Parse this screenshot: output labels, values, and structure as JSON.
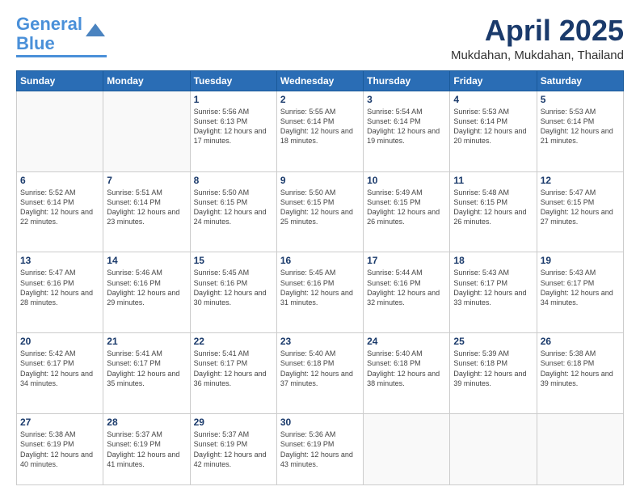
{
  "logo": {
    "line1": "General",
    "line2": "Blue"
  },
  "header": {
    "month": "April 2025",
    "location": "Mukdahan, Mukdahan, Thailand"
  },
  "weekdays": [
    "Sunday",
    "Monday",
    "Tuesday",
    "Wednesday",
    "Thursday",
    "Friday",
    "Saturday"
  ],
  "weeks": [
    [
      {
        "day": "",
        "info": ""
      },
      {
        "day": "",
        "info": ""
      },
      {
        "day": "1",
        "info": "Sunrise: 5:56 AM\nSunset: 6:13 PM\nDaylight: 12 hours and 17 minutes."
      },
      {
        "day": "2",
        "info": "Sunrise: 5:55 AM\nSunset: 6:14 PM\nDaylight: 12 hours and 18 minutes."
      },
      {
        "day": "3",
        "info": "Sunrise: 5:54 AM\nSunset: 6:14 PM\nDaylight: 12 hours and 19 minutes."
      },
      {
        "day": "4",
        "info": "Sunrise: 5:53 AM\nSunset: 6:14 PM\nDaylight: 12 hours and 20 minutes."
      },
      {
        "day": "5",
        "info": "Sunrise: 5:53 AM\nSunset: 6:14 PM\nDaylight: 12 hours and 21 minutes."
      }
    ],
    [
      {
        "day": "6",
        "info": "Sunrise: 5:52 AM\nSunset: 6:14 PM\nDaylight: 12 hours and 22 minutes."
      },
      {
        "day": "7",
        "info": "Sunrise: 5:51 AM\nSunset: 6:14 PM\nDaylight: 12 hours and 23 minutes."
      },
      {
        "day": "8",
        "info": "Sunrise: 5:50 AM\nSunset: 6:15 PM\nDaylight: 12 hours and 24 minutes."
      },
      {
        "day": "9",
        "info": "Sunrise: 5:50 AM\nSunset: 6:15 PM\nDaylight: 12 hours and 25 minutes."
      },
      {
        "day": "10",
        "info": "Sunrise: 5:49 AM\nSunset: 6:15 PM\nDaylight: 12 hours and 26 minutes."
      },
      {
        "day": "11",
        "info": "Sunrise: 5:48 AM\nSunset: 6:15 PM\nDaylight: 12 hours and 26 minutes."
      },
      {
        "day": "12",
        "info": "Sunrise: 5:47 AM\nSunset: 6:15 PM\nDaylight: 12 hours and 27 minutes."
      }
    ],
    [
      {
        "day": "13",
        "info": "Sunrise: 5:47 AM\nSunset: 6:16 PM\nDaylight: 12 hours and 28 minutes."
      },
      {
        "day": "14",
        "info": "Sunrise: 5:46 AM\nSunset: 6:16 PM\nDaylight: 12 hours and 29 minutes."
      },
      {
        "day": "15",
        "info": "Sunrise: 5:45 AM\nSunset: 6:16 PM\nDaylight: 12 hours and 30 minutes."
      },
      {
        "day": "16",
        "info": "Sunrise: 5:45 AM\nSunset: 6:16 PM\nDaylight: 12 hours and 31 minutes."
      },
      {
        "day": "17",
        "info": "Sunrise: 5:44 AM\nSunset: 6:16 PM\nDaylight: 12 hours and 32 minutes."
      },
      {
        "day": "18",
        "info": "Sunrise: 5:43 AM\nSunset: 6:17 PM\nDaylight: 12 hours and 33 minutes."
      },
      {
        "day": "19",
        "info": "Sunrise: 5:43 AM\nSunset: 6:17 PM\nDaylight: 12 hours and 34 minutes."
      }
    ],
    [
      {
        "day": "20",
        "info": "Sunrise: 5:42 AM\nSunset: 6:17 PM\nDaylight: 12 hours and 34 minutes."
      },
      {
        "day": "21",
        "info": "Sunrise: 5:41 AM\nSunset: 6:17 PM\nDaylight: 12 hours and 35 minutes."
      },
      {
        "day": "22",
        "info": "Sunrise: 5:41 AM\nSunset: 6:17 PM\nDaylight: 12 hours and 36 minutes."
      },
      {
        "day": "23",
        "info": "Sunrise: 5:40 AM\nSunset: 6:18 PM\nDaylight: 12 hours and 37 minutes."
      },
      {
        "day": "24",
        "info": "Sunrise: 5:40 AM\nSunset: 6:18 PM\nDaylight: 12 hours and 38 minutes."
      },
      {
        "day": "25",
        "info": "Sunrise: 5:39 AM\nSunset: 6:18 PM\nDaylight: 12 hours and 39 minutes."
      },
      {
        "day": "26",
        "info": "Sunrise: 5:38 AM\nSunset: 6:18 PM\nDaylight: 12 hours and 39 minutes."
      }
    ],
    [
      {
        "day": "27",
        "info": "Sunrise: 5:38 AM\nSunset: 6:19 PM\nDaylight: 12 hours and 40 minutes."
      },
      {
        "day": "28",
        "info": "Sunrise: 5:37 AM\nSunset: 6:19 PM\nDaylight: 12 hours and 41 minutes."
      },
      {
        "day": "29",
        "info": "Sunrise: 5:37 AM\nSunset: 6:19 PM\nDaylight: 12 hours and 42 minutes."
      },
      {
        "day": "30",
        "info": "Sunrise: 5:36 AM\nSunset: 6:19 PM\nDaylight: 12 hours and 43 minutes."
      },
      {
        "day": "",
        "info": ""
      },
      {
        "day": "",
        "info": ""
      },
      {
        "day": "",
        "info": ""
      }
    ]
  ]
}
